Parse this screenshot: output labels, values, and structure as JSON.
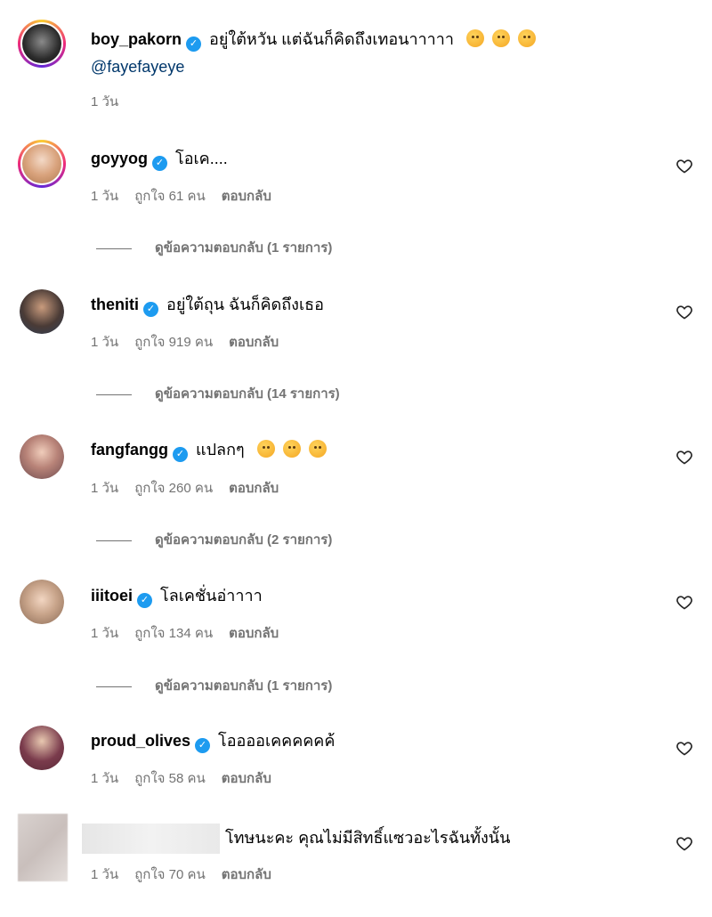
{
  "post": {
    "username": "boy_pakorn",
    "text": "อยู่ใต้หวัน แต่ฉันก็คิดถึงเทอนาาาาา",
    "mention": "@fayefayeye",
    "time": "1 วัน"
  },
  "comments": [
    {
      "username": "goyyog",
      "text": "โอเค....",
      "time": "1 วัน",
      "likes": "ถูกใจ 61 คน",
      "reply": "ตอบกลับ",
      "view_replies": "ดูข้อความตอบกลับ (1 รายการ)"
    },
    {
      "username": "theniti",
      "text": "อยู่ใต้ถุน ฉันก็คิดถึงเธอ",
      "time": "1 วัน",
      "likes": "ถูกใจ 919 คน",
      "reply": "ตอบกลับ",
      "view_replies": "ดูข้อความตอบกลับ (14 รายการ)"
    },
    {
      "username": "fangfangg",
      "text": "แปลกๆ",
      "time": "1 วัน",
      "likes": "ถูกใจ 260 คน",
      "reply": "ตอบกลับ",
      "view_replies": "ดูข้อความตอบกลับ (2 รายการ)"
    },
    {
      "username": "iiitoei",
      "text": "โลเคชั่นอ่าาาา",
      "time": "1 วัน",
      "likes": "ถูกใจ 134 คน",
      "reply": "ตอบกลับ",
      "view_replies": "ดูข้อความตอบกลับ (1 รายการ)"
    },
    {
      "username": "proud_olives",
      "text": "โออออเคคคคคค้",
      "time": "1 วัน",
      "likes": "ถูกใจ 58 คน",
      "reply": "ตอบกลับ"
    },
    {
      "text": "โทษนะคะ คุณไม่มีสิทธิ์แซวอะไรฉันทั้งนั้น",
      "time": "1 วัน",
      "likes": "ถูกใจ 70 คน",
      "reply": "ตอบกลับ"
    }
  ],
  "colors": {
    "verified": "#1d9bf0",
    "mention": "#00376b",
    "muted": "#737373"
  },
  "icons": {
    "verified": "verified-badge-icon",
    "like": "heart-outline-icon"
  }
}
